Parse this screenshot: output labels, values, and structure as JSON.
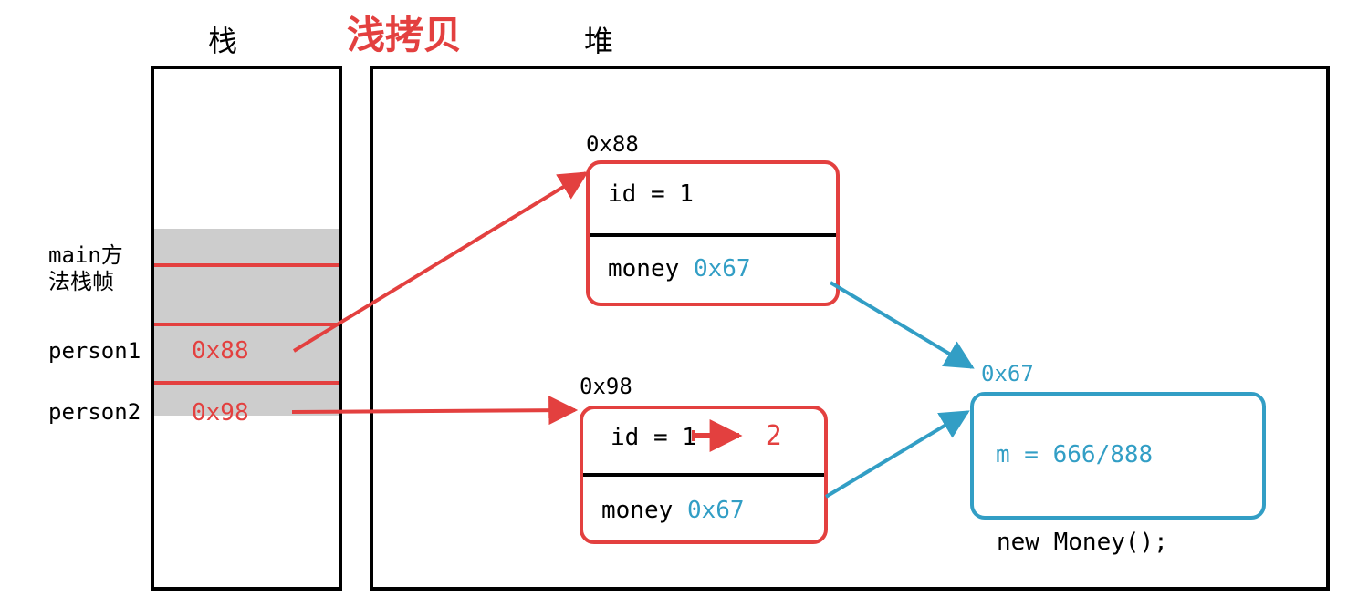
{
  "labels": {
    "stack": "栈",
    "shallow_copy": "浅拷贝",
    "heap": "堆",
    "main_frame": "main方\n法栈帧",
    "person1": "person1",
    "person2": "person2",
    "new_money": "new Money();"
  },
  "stack": {
    "person1_addr": "0x88",
    "person2_addr": "0x98"
  },
  "heap": {
    "obj1": {
      "addr": "0x88",
      "id": "id = 1",
      "money_label": "money",
      "money_addr": "0x67"
    },
    "obj2": {
      "addr": "0x98",
      "id_label": "id =",
      "id_old": "1",
      "id_new": "2",
      "money_label": "money",
      "money_addr": "0x67"
    },
    "money": {
      "addr": "0x67",
      "value": "m = 666/888"
    }
  },
  "colors": {
    "red": "#e3403f",
    "blue": "#329ec5",
    "grey": "#cdcdcd"
  }
}
